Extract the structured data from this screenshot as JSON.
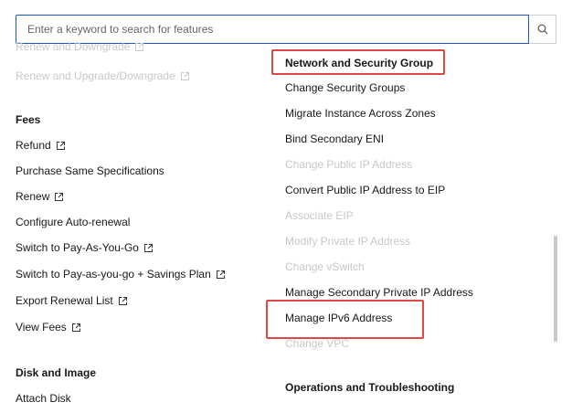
{
  "search": {
    "placeholder": "Enter a keyword to search for features",
    "value": ""
  },
  "left_column": {
    "top_items": [
      {
        "label": "Renew and Downgrade",
        "disabled": true,
        "external": true
      },
      {
        "label": "Renew and Upgrade/Downgrade",
        "disabled": true,
        "external": true
      }
    ],
    "fees": {
      "heading": "Fees",
      "items": [
        {
          "label": "Refund",
          "external": true
        },
        {
          "label": "Purchase Same Specifications",
          "external": false
        },
        {
          "label": "Renew",
          "external": true
        },
        {
          "label": "Configure Auto-renewal",
          "external": false
        },
        {
          "label": "Switch to Pay-As-You-Go",
          "external": true
        },
        {
          "label": "Switch to Pay-as-you-go + Savings Plan",
          "external": true
        },
        {
          "label": "Export Renewal List",
          "external": true
        },
        {
          "label": "View Fees",
          "external": true
        }
      ]
    },
    "disk": {
      "heading": "Disk and Image",
      "items": [
        {
          "label": "Attach Disk"
        }
      ]
    }
  },
  "right_column": {
    "network": {
      "heading": "Network and Security Group",
      "items": [
        {
          "label": "Change Security Groups",
          "disabled": false
        },
        {
          "label": "Migrate Instance Across Zones",
          "disabled": false
        },
        {
          "label": "Bind Secondary ENI",
          "disabled": false
        },
        {
          "label": "Change Public IP Address",
          "disabled": true
        },
        {
          "label": "Convert Public IP Address to EIP",
          "disabled": false
        },
        {
          "label": "Associate EIP",
          "disabled": true
        },
        {
          "label": "Modify Private IP Address",
          "disabled": true
        },
        {
          "label": "Change vSwitch",
          "disabled": true
        },
        {
          "label": "Manage Secondary Private IP Address",
          "disabled": false
        },
        {
          "label": "Manage IPv6 Address",
          "disabled": false
        },
        {
          "label": "Change VPC",
          "disabled": true
        }
      ]
    },
    "ops": {
      "heading": "Operations and Troubleshooting"
    }
  },
  "colors": {
    "highlight": "#e04848",
    "input_border": "#1b58c4",
    "disabled_text": "#c8c8c8"
  }
}
